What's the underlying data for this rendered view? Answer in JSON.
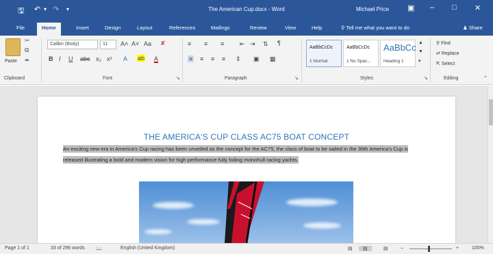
{
  "titlebar": {
    "doc_title": "The American Cup.docx - Word",
    "user": "Michael Price",
    "save_icon": "save-icon",
    "undo_icon": "undo-icon",
    "redo_icon": "redo-icon",
    "ribbon_display_icon": "ribbon-display-options-icon",
    "minimize_icon": "minimize-icon",
    "maximize_icon": "maximize-icon",
    "close_icon": "close-icon"
  },
  "tabs": {
    "file": "File",
    "home": "Home",
    "insert": "Insert",
    "design": "Design",
    "layout": "Layout",
    "references": "References",
    "mailings": "Mailings",
    "review": "Review",
    "view": "View",
    "help": "Help",
    "tell_me": "Tell me what you want to do",
    "share": "Share"
  },
  "ribbon": {
    "clipboard": {
      "label": "Clipboard",
      "paste": "Paste"
    },
    "font": {
      "label": "Font",
      "font_name": "Calibri (Body)",
      "font_size": "11"
    },
    "paragraph": {
      "label": "Paragraph"
    },
    "styles": {
      "label": "Styles",
      "items": [
        {
          "sample": "AaBbCcDc",
          "name": "1 Normal"
        },
        {
          "sample": "AaBbCcDc",
          "name": "1 No Spac..."
        },
        {
          "sample": "AaBbCc",
          "name": "Heading 1"
        }
      ]
    },
    "editing": {
      "label": "Editing",
      "find": "Find",
      "replace": "Replace",
      "select": "Select"
    }
  },
  "document": {
    "heading": "THE AMERICA'S CUP CLASS AC75 BOAT CONCEPT",
    "paragraph": "An exciting new era in America's Cup racing has been unveiled as the concept for the AC75, the class of boat to be sailed in the 36th America's Cup is released illustrating a bold and modern vision for high performance fully foiling monohull racing yachts.",
    "image_name": "sailing-yacht-photo"
  },
  "status": {
    "page": "Page 1 of 1",
    "words": "33 of 296 words",
    "language": "English (United Kingdom)",
    "zoom": "100%"
  },
  "colors": {
    "accent": "#2b579a",
    "heading": "#2e74b5",
    "highlight": "#bdbdbd"
  }
}
